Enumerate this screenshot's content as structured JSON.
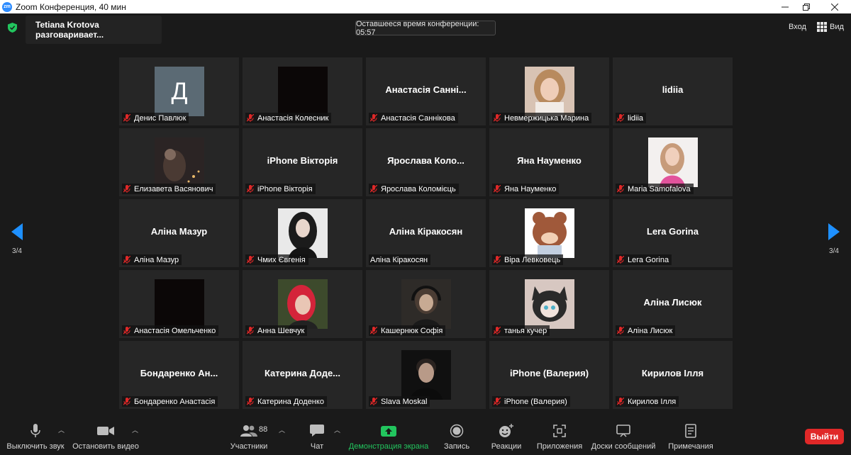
{
  "window": {
    "title": "Zoom Конференция, 40 мин",
    "logo": "zm"
  },
  "header": {
    "speaking": "Tetiana Krotova разговаривает...",
    "timer": "Оставшееся время конференции: 05:57",
    "login": "Вход",
    "view": "Вид"
  },
  "nav": {
    "page_left": "3/4",
    "page_right": "3/4"
  },
  "participants": [
    {
      "label": "Денис Павлюк",
      "display": "",
      "photo": "letter-avatar",
      "letter": "Д"
    },
    {
      "label": "Анастасія Колесник",
      "display": "",
      "photo": "dark-video"
    },
    {
      "label": "Анастасія Саннікова",
      "display": "Анастасія Санні...",
      "photo": ""
    },
    {
      "label": "Невмержицька Марина",
      "display": "",
      "photo": "girl-blonde"
    },
    {
      "label": "lidiia",
      "display": "lidiia",
      "photo": ""
    },
    {
      "label": "Елизавета Васянович",
      "display": "",
      "photo": "night-city"
    },
    {
      "label": "iPhone Вікторія",
      "display": "iPhone Вікторія",
      "photo": ""
    },
    {
      "label": "Ярослава Коломієць",
      "display": "Ярослава Коло...",
      "photo": ""
    },
    {
      "label": "Яна Науменко",
      "display": "Яна Науменко",
      "photo": ""
    },
    {
      "label": "Maria Samofalova",
      "display": "",
      "photo": "girl-pink"
    },
    {
      "label": "Аліна Мазур",
      "display": "Аліна Мазур",
      "photo": ""
    },
    {
      "label": "Чмих Євгенія",
      "display": "",
      "photo": "girl-dark-hair"
    },
    {
      "label": "Аліна Кіракосян",
      "display": "Аліна Кіракосян",
      "photo": "",
      "muted": false
    },
    {
      "label": "Віра Левковець",
      "display": "",
      "photo": "cartoon-bear"
    },
    {
      "label": "Lera Gorina",
      "display": "Lera Gorina",
      "photo": ""
    },
    {
      "label": "Анастасія Омельченко",
      "display": "",
      "photo": "dark-video"
    },
    {
      "label": "Анна Шевчук",
      "display": "",
      "photo": "girl-red-hair"
    },
    {
      "label": "Кашернюк Софія",
      "display": "",
      "photo": "boy-headphones"
    },
    {
      "label": "танья кучер",
      "display": "",
      "photo": "cartoon-cat"
    },
    {
      "label": "Аліна Лисюк",
      "display": "Аліна Лисюк",
      "photo": ""
    },
    {
      "label": "Бондаренко Анастасія",
      "display": "Бондаренко Ан...",
      "photo": ""
    },
    {
      "label": "Катерина Доденко",
      "display": "Катерина Доде...",
      "photo": ""
    },
    {
      "label": "Slava Moskal",
      "display": "",
      "photo": "boy-portrait"
    },
    {
      "label": "iPhone (Валерия)",
      "display": "iPhone (Валерия)",
      "photo": ""
    },
    {
      "label": "Кирилов Ілля",
      "display": "Кирилов Ілля",
      "photo": ""
    }
  ],
  "toolbar": {
    "mute": "Выключить звук",
    "video": "Остановить видео",
    "participants": "Участники",
    "participants_count": "88",
    "chat": "Чат",
    "share": "Демонстрация экрана",
    "record": "Запись",
    "reactions": "Реакции",
    "apps": "Приложения",
    "whiteboards": "Доски сообщений",
    "notes": "Примечания",
    "leave": "Выйти"
  },
  "colors": {
    "accent": "#1e90ff",
    "share": "#22c55e",
    "leave": "#e02828",
    "muted": "#e02828"
  }
}
